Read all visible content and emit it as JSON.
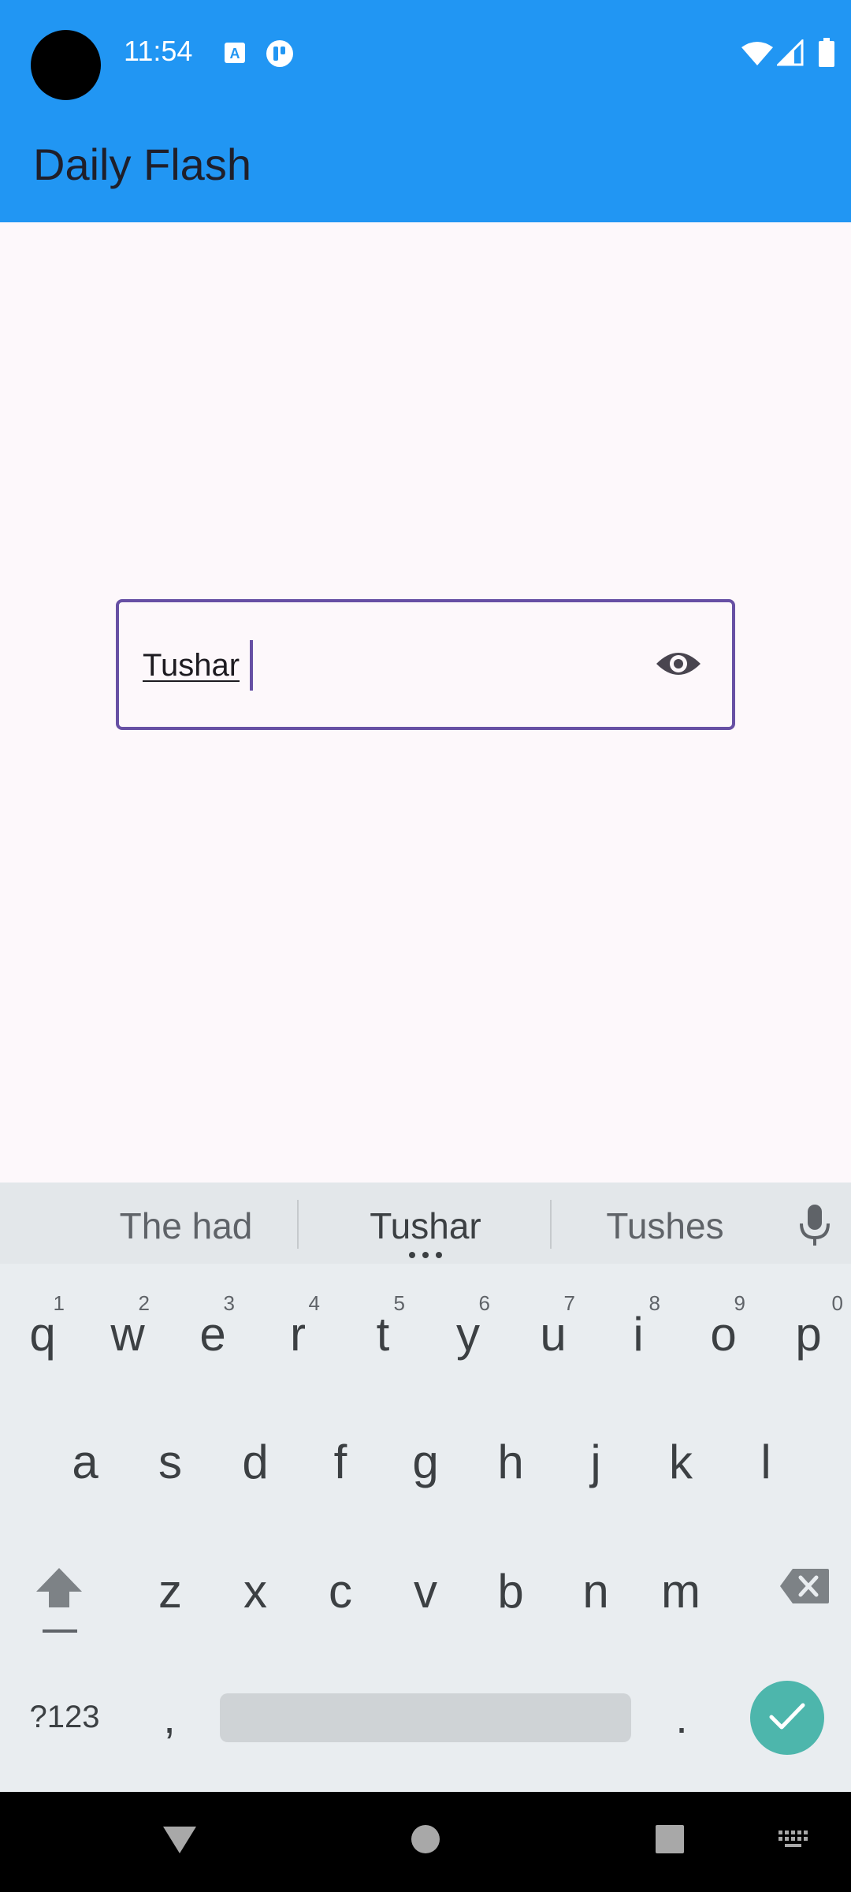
{
  "status_bar": {
    "time": "11:54",
    "icons": [
      "font-a-icon",
      "app-badge-icon",
      "wifi-icon",
      "signal-icon",
      "battery-icon"
    ]
  },
  "app_bar": {
    "title": "Daily Flash",
    "background": "#2196f3"
  },
  "form": {
    "field_value": "Tushar",
    "field_border_color": "#6750a4",
    "trailing_icon": "eye-icon"
  },
  "keyboard": {
    "suggestions": [
      "The had",
      "Tushar",
      "Tushes"
    ],
    "row1": [
      {
        "key": "q",
        "hint": "1"
      },
      {
        "key": "w",
        "hint": "2"
      },
      {
        "key": "e",
        "hint": "3"
      },
      {
        "key": "r",
        "hint": "4"
      },
      {
        "key": "t",
        "hint": "5"
      },
      {
        "key": "y",
        "hint": "6"
      },
      {
        "key": "u",
        "hint": "7"
      },
      {
        "key": "i",
        "hint": "8"
      },
      {
        "key": "o",
        "hint": "9"
      },
      {
        "key": "p",
        "hint": "0"
      }
    ],
    "row2": [
      "a",
      "s",
      "d",
      "f",
      "g",
      "h",
      "j",
      "k",
      "l"
    ],
    "row3": [
      "z",
      "x",
      "c",
      "v",
      "b",
      "n",
      "m"
    ],
    "symbols_label": "?123",
    "comma_label": ",",
    "period_label": ".",
    "enter_color": "#4db6ac"
  },
  "nav_bar": {
    "buttons": [
      "back-icon",
      "home-icon",
      "recents-icon",
      "keyboard-switch-icon"
    ]
  }
}
